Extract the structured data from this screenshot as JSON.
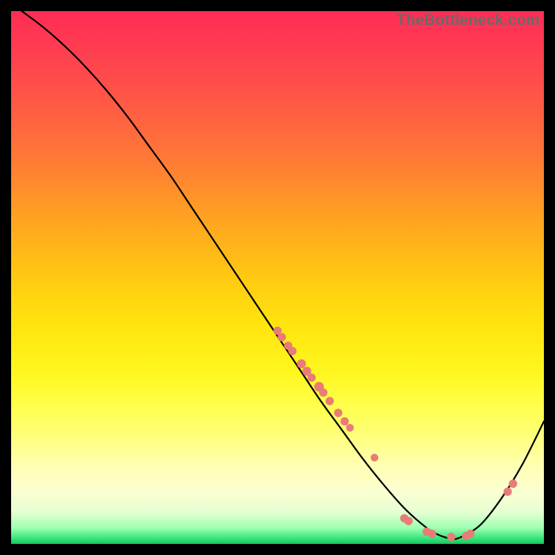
{
  "watermark": "TheBottleneck.com",
  "chart_data": {
    "type": "line",
    "title": "",
    "xlabel": "",
    "ylabel": "",
    "xlim": [
      0,
      100
    ],
    "ylim": [
      0,
      100
    ],
    "series": [
      {
        "name": "curve",
        "x": [
          2,
          6,
          10,
          14,
          18,
          22,
          26,
          30,
          34,
          38,
          42,
          46,
          50,
          54,
          58,
          62,
          66,
          70,
          74,
          78,
          80,
          82,
          84,
          88,
          92,
          96,
          100
        ],
        "y": [
          100,
          97,
          93.5,
          89.5,
          85,
          80,
          74.5,
          69,
          63,
          57,
          51,
          45,
          39,
          33,
          27,
          21.5,
          16,
          11,
          6.5,
          3,
          1.8,
          1.1,
          1.1,
          3.5,
          8.5,
          15,
          23
        ]
      }
    ],
    "scatter_points": [
      {
        "x": 50,
        "y": 40,
        "r": 6
      },
      {
        "x": 50.8,
        "y": 38.8,
        "r": 6
      },
      {
        "x": 52,
        "y": 37.2,
        "r": 6
      },
      {
        "x": 52.8,
        "y": 36.2,
        "r": 6
      },
      {
        "x": 54.5,
        "y": 33.8,
        "r": 6.5
      },
      {
        "x": 55.5,
        "y": 32.4,
        "r": 6.5
      },
      {
        "x": 56.4,
        "y": 31.2,
        "r": 6
      },
      {
        "x": 57.8,
        "y": 29.5,
        "r": 7
      },
      {
        "x": 58.6,
        "y": 28.4,
        "r": 6
      },
      {
        "x": 59.8,
        "y": 26.8,
        "r": 6
      },
      {
        "x": 61.4,
        "y": 24.6,
        "r": 6
      },
      {
        "x": 62.6,
        "y": 23,
        "r": 6
      },
      {
        "x": 63.6,
        "y": 21.8,
        "r": 5.5
      },
      {
        "x": 68.2,
        "y": 16.2,
        "r": 5.5
      },
      {
        "x": 73.8,
        "y": 4.8,
        "r": 6
      },
      {
        "x": 74.6,
        "y": 4.3,
        "r": 6
      },
      {
        "x": 78,
        "y": 2.3,
        "r": 6
      },
      {
        "x": 79,
        "y": 1.9,
        "r": 6
      },
      {
        "x": 82.6,
        "y": 1.3,
        "r": 6
      },
      {
        "x": 85.4,
        "y": 1.5,
        "r": 6
      },
      {
        "x": 86.2,
        "y": 1.9,
        "r": 6
      },
      {
        "x": 93.2,
        "y": 9.8,
        "r": 6
      },
      {
        "x": 94.2,
        "y": 11.3,
        "r": 6
      }
    ]
  }
}
